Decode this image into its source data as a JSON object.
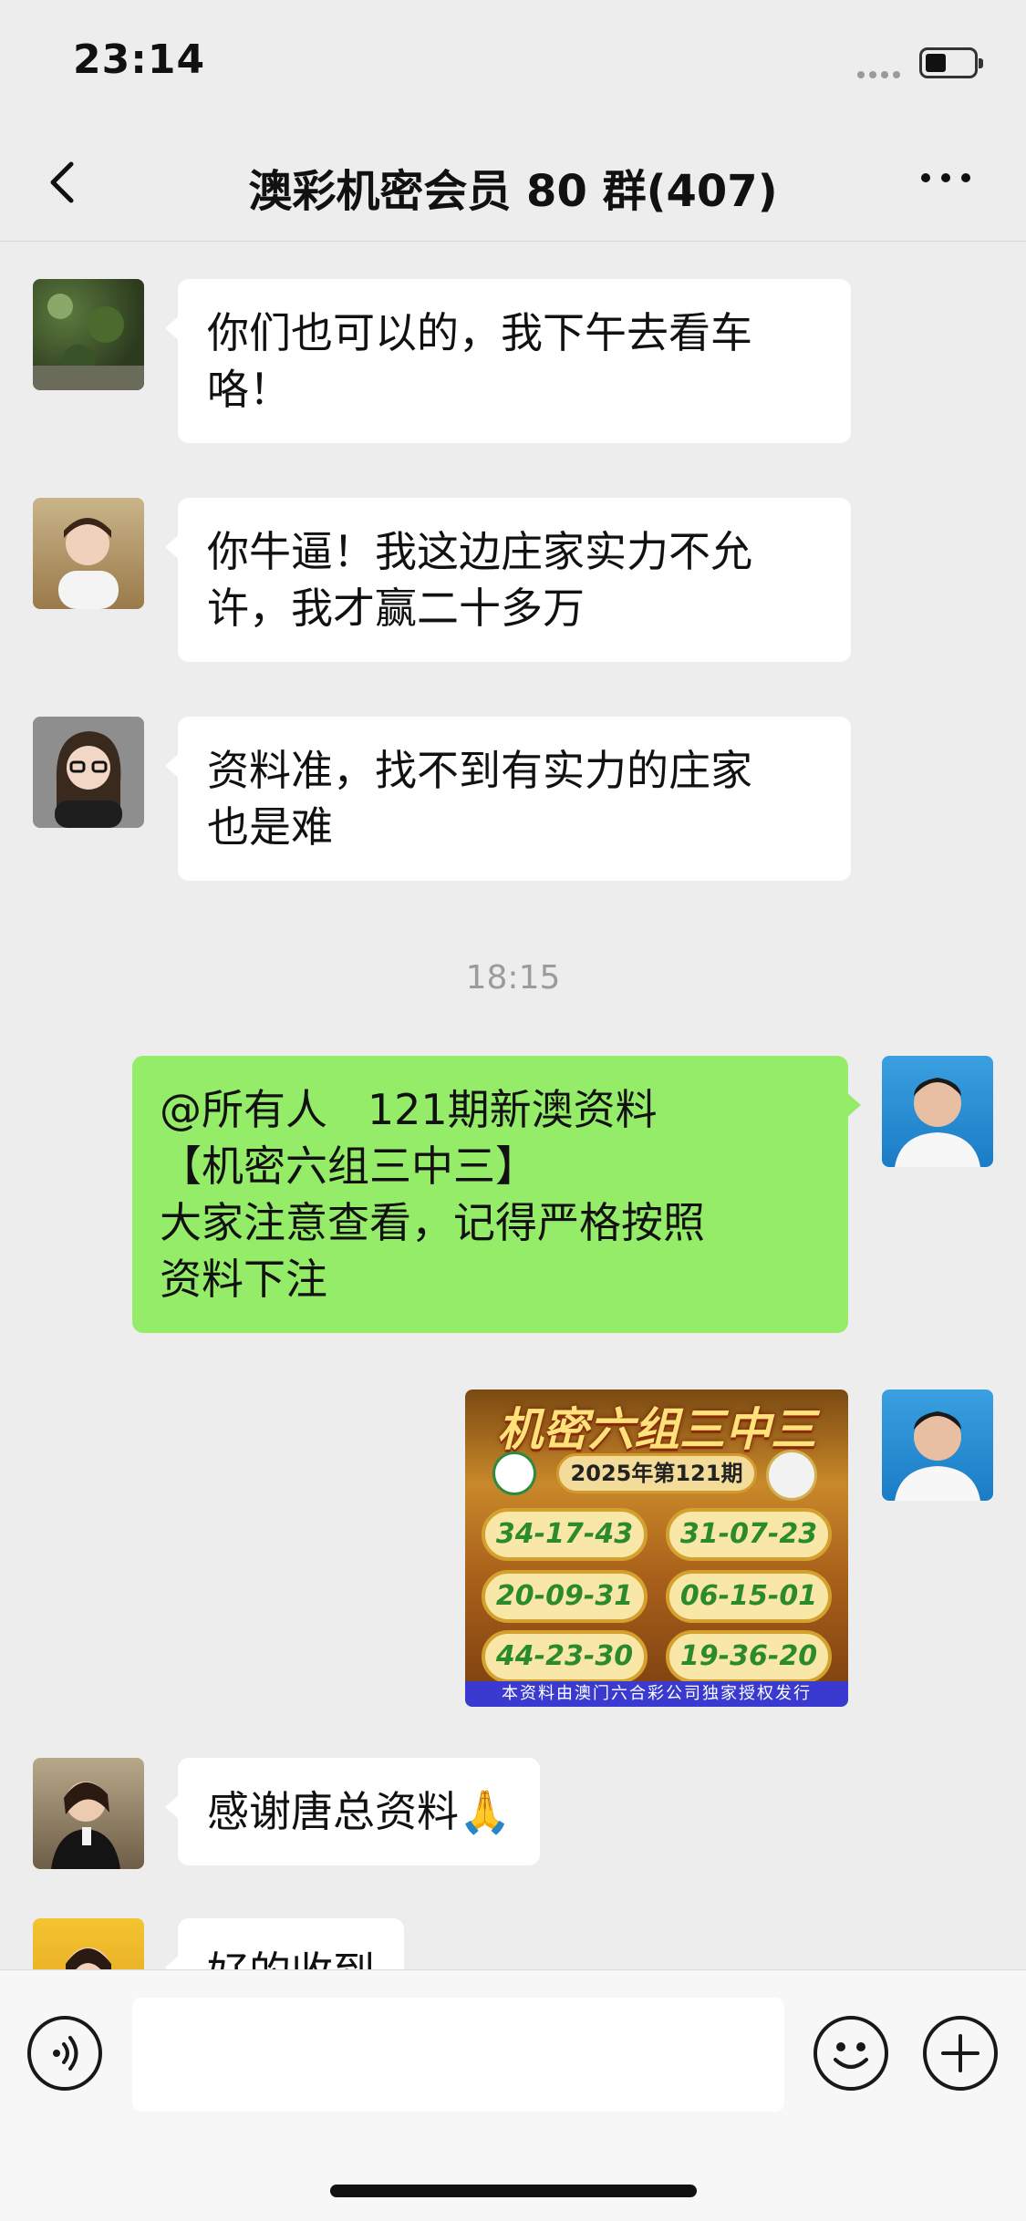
{
  "status": {
    "time": "23:14"
  },
  "nav": {
    "title": "澳彩机密会员 80 群(407)"
  },
  "messages": [
    {
      "side": "left",
      "lines": [
        "你们也可以的，我下午去看车",
        "咯！"
      ]
    },
    {
      "side": "left",
      "lines": [
        "你牛逼！我这边庄家实力不允",
        "许，我才赢二十多万"
      ]
    },
    {
      "side": "left",
      "lines": [
        "资料准，找不到有实力的庄家",
        "也是难"
      ]
    },
    {
      "side": "right",
      "lines": [
        "@所有人   121期新澳资料",
        "【机密六组三中三】",
        "大家注意查看，记得严格按照",
        "资料下注"
      ]
    },
    {
      "side": "left",
      "lines": [
        "感谢唐总资料🙏"
      ]
    },
    {
      "side": "left",
      "lines": [
        "好的收到"
      ]
    }
  ],
  "timestamp": "18:15",
  "lottery_image": {
    "title": "机密六组三中三",
    "period": "2025年第121期",
    "numbers": [
      "34-17-43",
      "31-07-23",
      "20-09-31",
      "06-15-01",
      "44-23-30",
      "19-36-20"
    ],
    "footer": "本资料由澳门六合彩公司独家授权发行"
  },
  "input": {
    "placeholder": ""
  },
  "colors": {
    "sent_bubble": "#95ec69",
    "received_bubble": "#ffffff",
    "background": "#ededed"
  },
  "icons": {
    "back": "chevron-left-icon",
    "more": "more-dots-icon",
    "voice": "voice-icon",
    "emoji": "emoji-icon",
    "plus": "plus-icon"
  }
}
